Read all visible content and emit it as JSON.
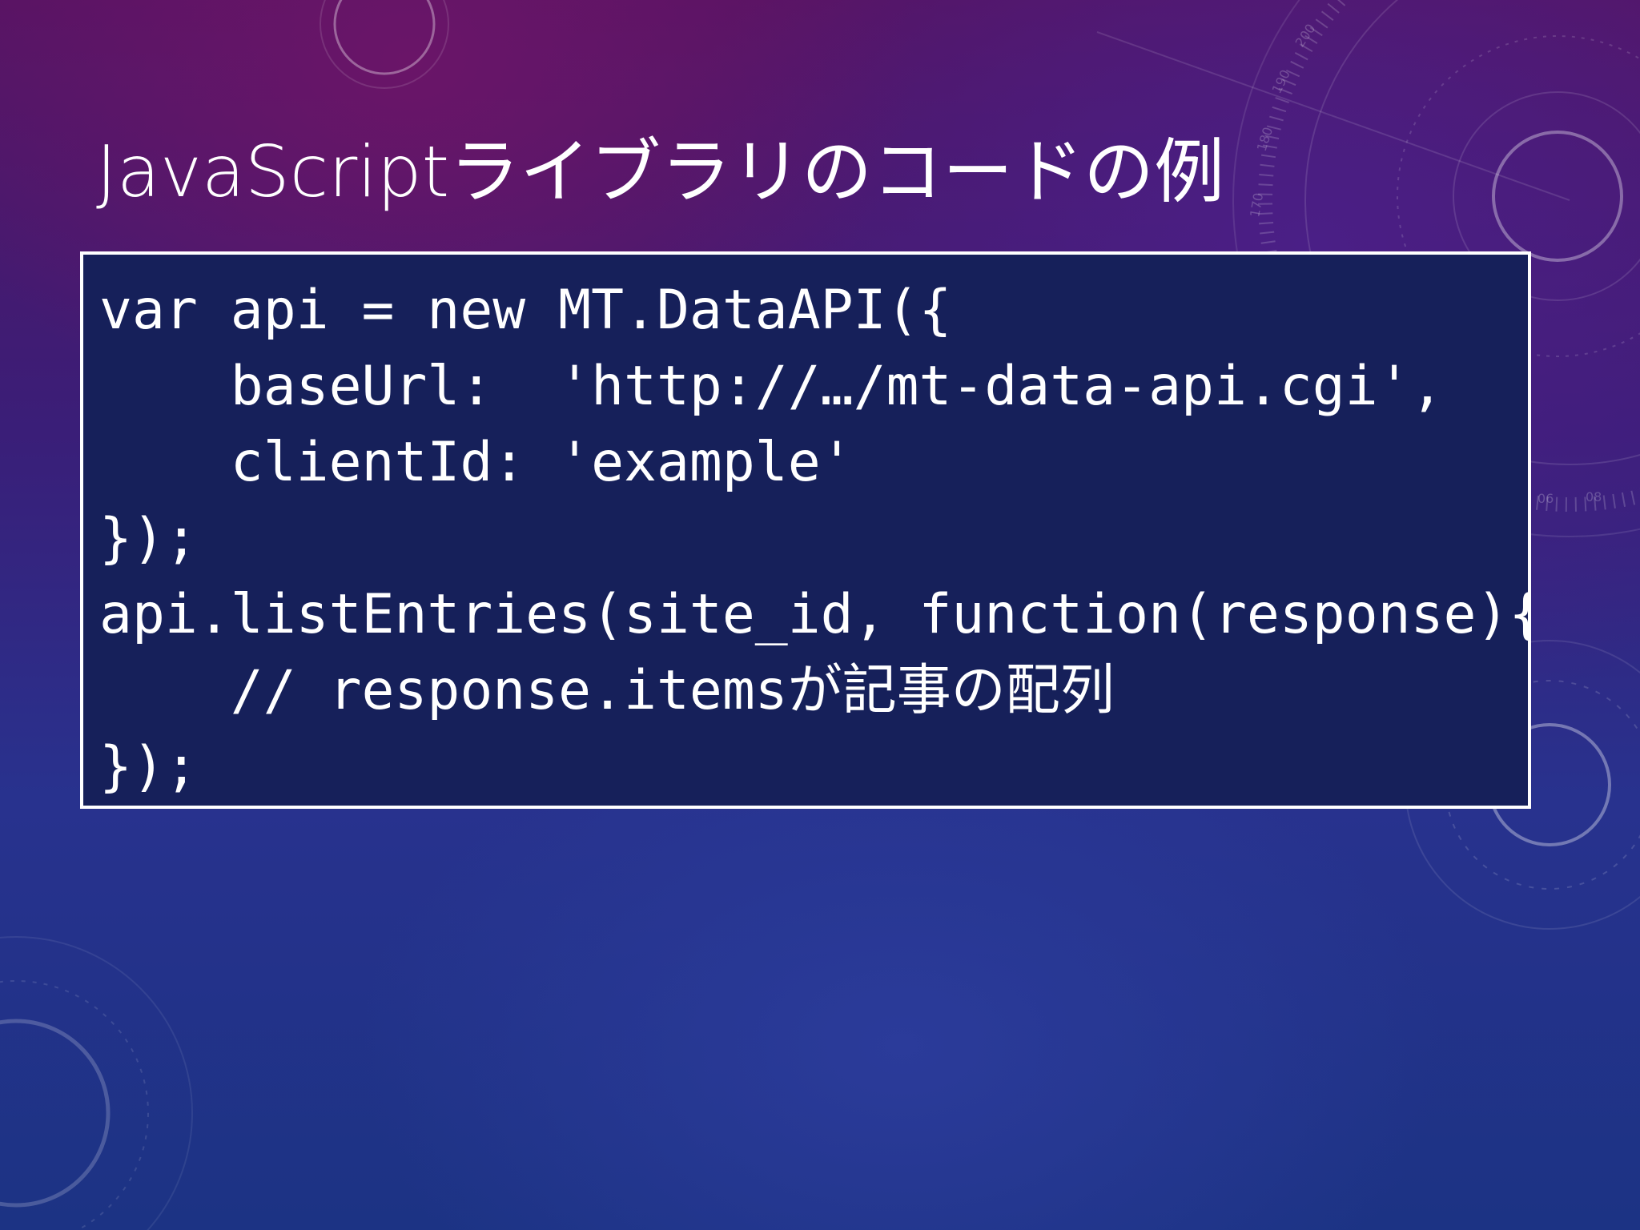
{
  "slide": {
    "title_latin": "JavaScript",
    "title_jp": "ライブラリのコードの例"
  },
  "code": {
    "lines": [
      "var api = new MT.DataAPI({",
      "    baseUrl:  'http://…/mt-data-api.cgi',",
      "    clientId: 'example'",
      "});",
      "api.listEntries(site_id, function(response){",
      "    // response.itemsが記事の配列",
      "});"
    ]
  },
  "decoration": {
    "dial_numbers": [
      "170",
      "180",
      "190",
      "200",
      "06",
      "08"
    ]
  },
  "colors": {
    "background_top": "#561463",
    "background_bottom": "#1c3384",
    "code_background": "#16205a",
    "text": "#ffffff"
  }
}
